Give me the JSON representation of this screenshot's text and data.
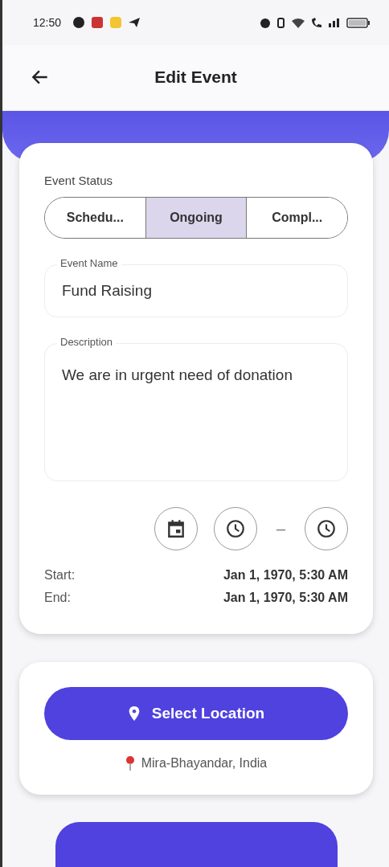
{
  "status_bar": {
    "time": "12:50"
  },
  "app_bar": {
    "title": "Edit Event"
  },
  "event_status": {
    "label": "Event Status",
    "options": [
      {
        "label": "Schedu...",
        "selected": false
      },
      {
        "label": "Ongoing",
        "selected": true
      },
      {
        "label": "Compl...",
        "selected": false
      }
    ]
  },
  "event_name": {
    "label": "Event Name",
    "value": "Fund Raising"
  },
  "description": {
    "label": "Description",
    "value": "We are in urgent need of donation"
  },
  "time_separator": "–",
  "schedule": [
    {
      "label": "Start:",
      "value": "Jan 1, 1970, 5:30 AM"
    },
    {
      "label": "End:",
      "value": "Jan 1, 1970, 5:30 AM"
    }
  ],
  "location": {
    "button": "Select Location",
    "place": "Mira-Bhayandar, India"
  }
}
